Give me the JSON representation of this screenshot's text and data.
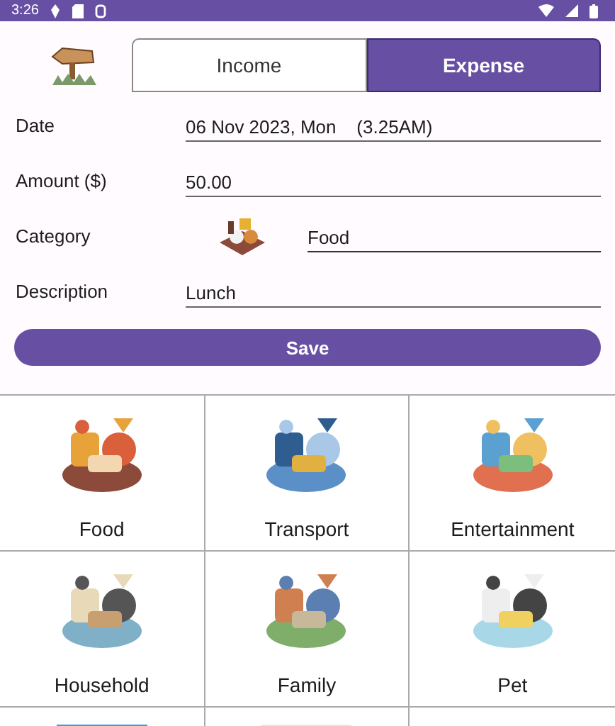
{
  "status_bar": {
    "time": "3:26"
  },
  "tabs": [
    {
      "label": "Income",
      "selected": false
    },
    {
      "label": "Expense",
      "selected": true
    }
  ],
  "form": [
    {
      "label": "Date",
      "value": "06 Nov 2023, Mon    (3.25AM)",
      "kind": "text"
    },
    {
      "label": "Amount ($)",
      "value": "50.00",
      "kind": "text"
    },
    {
      "label": "Category",
      "value": "Food",
      "kind": "category"
    },
    {
      "label": "Description",
      "value": "Lunch",
      "kind": "text"
    }
  ],
  "save_button": "Save",
  "categories": [
    {
      "label": "Food",
      "kind": "labeled"
    },
    {
      "label": "Transport",
      "kind": "labeled"
    },
    {
      "label": "Entertainment",
      "kind": "labeled"
    },
    {
      "label": "Household",
      "kind": "labeled"
    },
    {
      "label": "Family",
      "kind": "labeled"
    },
    {
      "label": "Pet",
      "kind": "labeled"
    },
    {
      "kind": "picture"
    },
    {
      "kind": "picture"
    },
    {
      "kind": "empty"
    }
  ]
}
